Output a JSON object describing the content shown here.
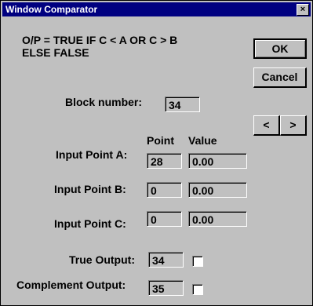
{
  "window": {
    "title": "Window Comparator",
    "close_glyph": "×"
  },
  "description": {
    "line1": "O/P = TRUE IF C < A OR C > B",
    "line2": "ELSE FALSE"
  },
  "buttons": {
    "ok": "OK",
    "cancel": "Cancel",
    "prev": "<",
    "next": ">"
  },
  "block": {
    "label": "Block number:",
    "value": "34"
  },
  "columns": {
    "point": "Point",
    "value": "Value"
  },
  "inputs": [
    {
      "label": "Input Point A:",
      "point": "28",
      "value": "0.00"
    },
    {
      "label": "Input Point B:",
      "point": "0",
      "value": "0.00"
    },
    {
      "label": "Input Point C:",
      "point": "0",
      "value": "0.00"
    }
  ],
  "outputs": [
    {
      "label": "True Output:",
      "value": "34",
      "checked": false
    },
    {
      "label": "Complement Output:",
      "value": "35",
      "checked": false
    }
  ]
}
